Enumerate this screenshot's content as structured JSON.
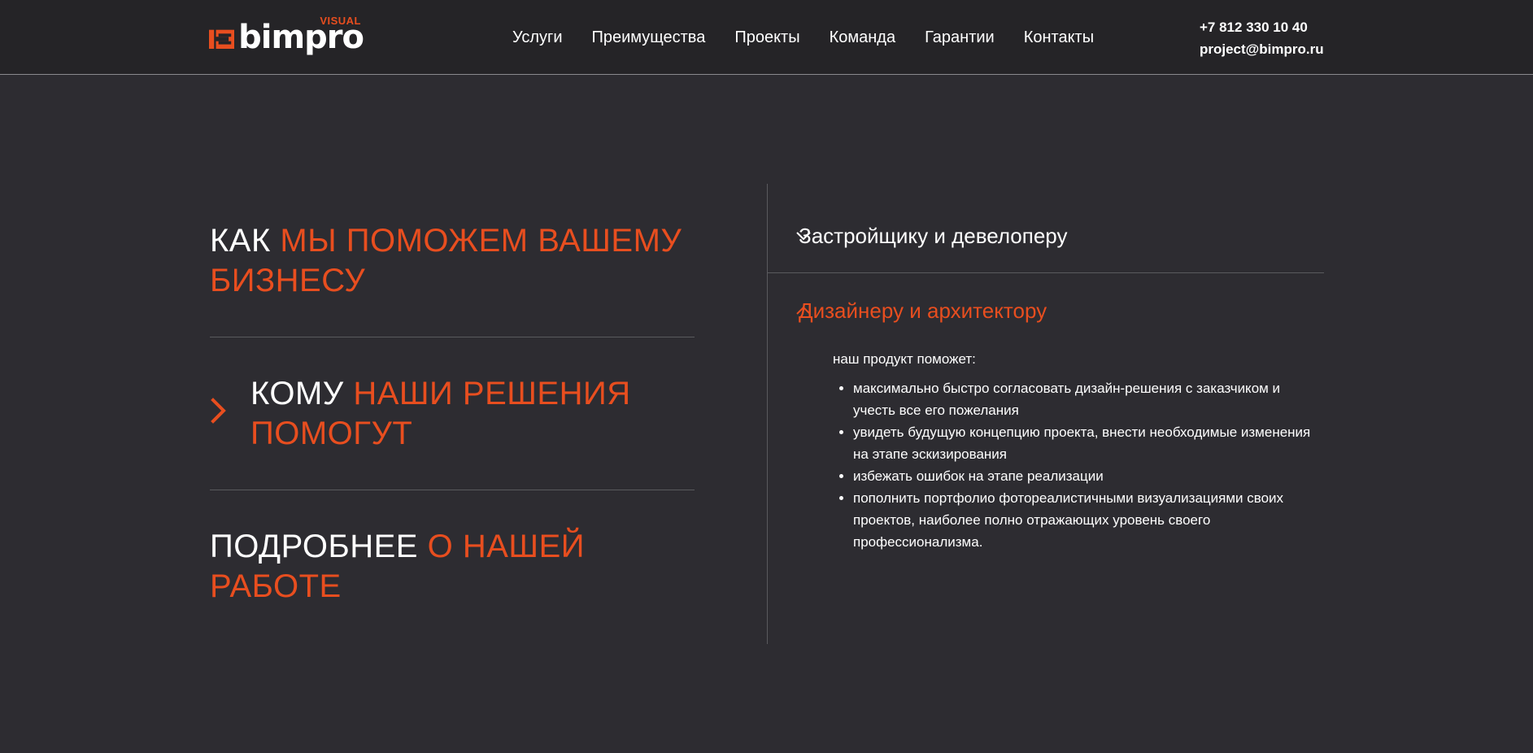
{
  "brand": {
    "name": "bimpro",
    "sub": "VISUAL",
    "accent": "#e84e1f",
    "background": "#2d2c31",
    "header_background": "#252427"
  },
  "nav": [
    "Услуги",
    "Преимущества",
    "Проекты",
    "Команда",
    "Гарантии",
    "Контакты"
  ],
  "contacts": {
    "phone": "+7 812 330 10 40",
    "email": "project@bimpro.ru"
  },
  "left": {
    "block1": {
      "white": "КАК ",
      "orange": "МЫ ПОМОЖЕМ ВАШЕМУ БИЗНЕСУ"
    },
    "block2": {
      "white": "КОМУ ",
      "orange": "НАШИ РЕШЕНИЯ ПОМОГУТ"
    },
    "block3": {
      "white": "ПОДРОБНЕЕ ",
      "orange": "О НАШЕЙ РАБОТЕ"
    }
  },
  "accordion": [
    {
      "title": "Застройщику и девелоперу",
      "expanded": false
    },
    {
      "title": "Дизайнеру и архитектору",
      "expanded": true,
      "intro": "наш продукт поможет:",
      "items": [
        "максимально быстро согласовать дизайн-решения с заказчиком и учесть все его пожелания",
        "увидеть будущую концепцию проекта, внести необходимые изменения на этапе эскизирования",
        "избежать ошибок на этапе реализации",
        "пополнить портфолио фотореалистичными визуализациями своих проектов, наиболее полно отражающих уровень своего профессионализма."
      ]
    }
  ]
}
